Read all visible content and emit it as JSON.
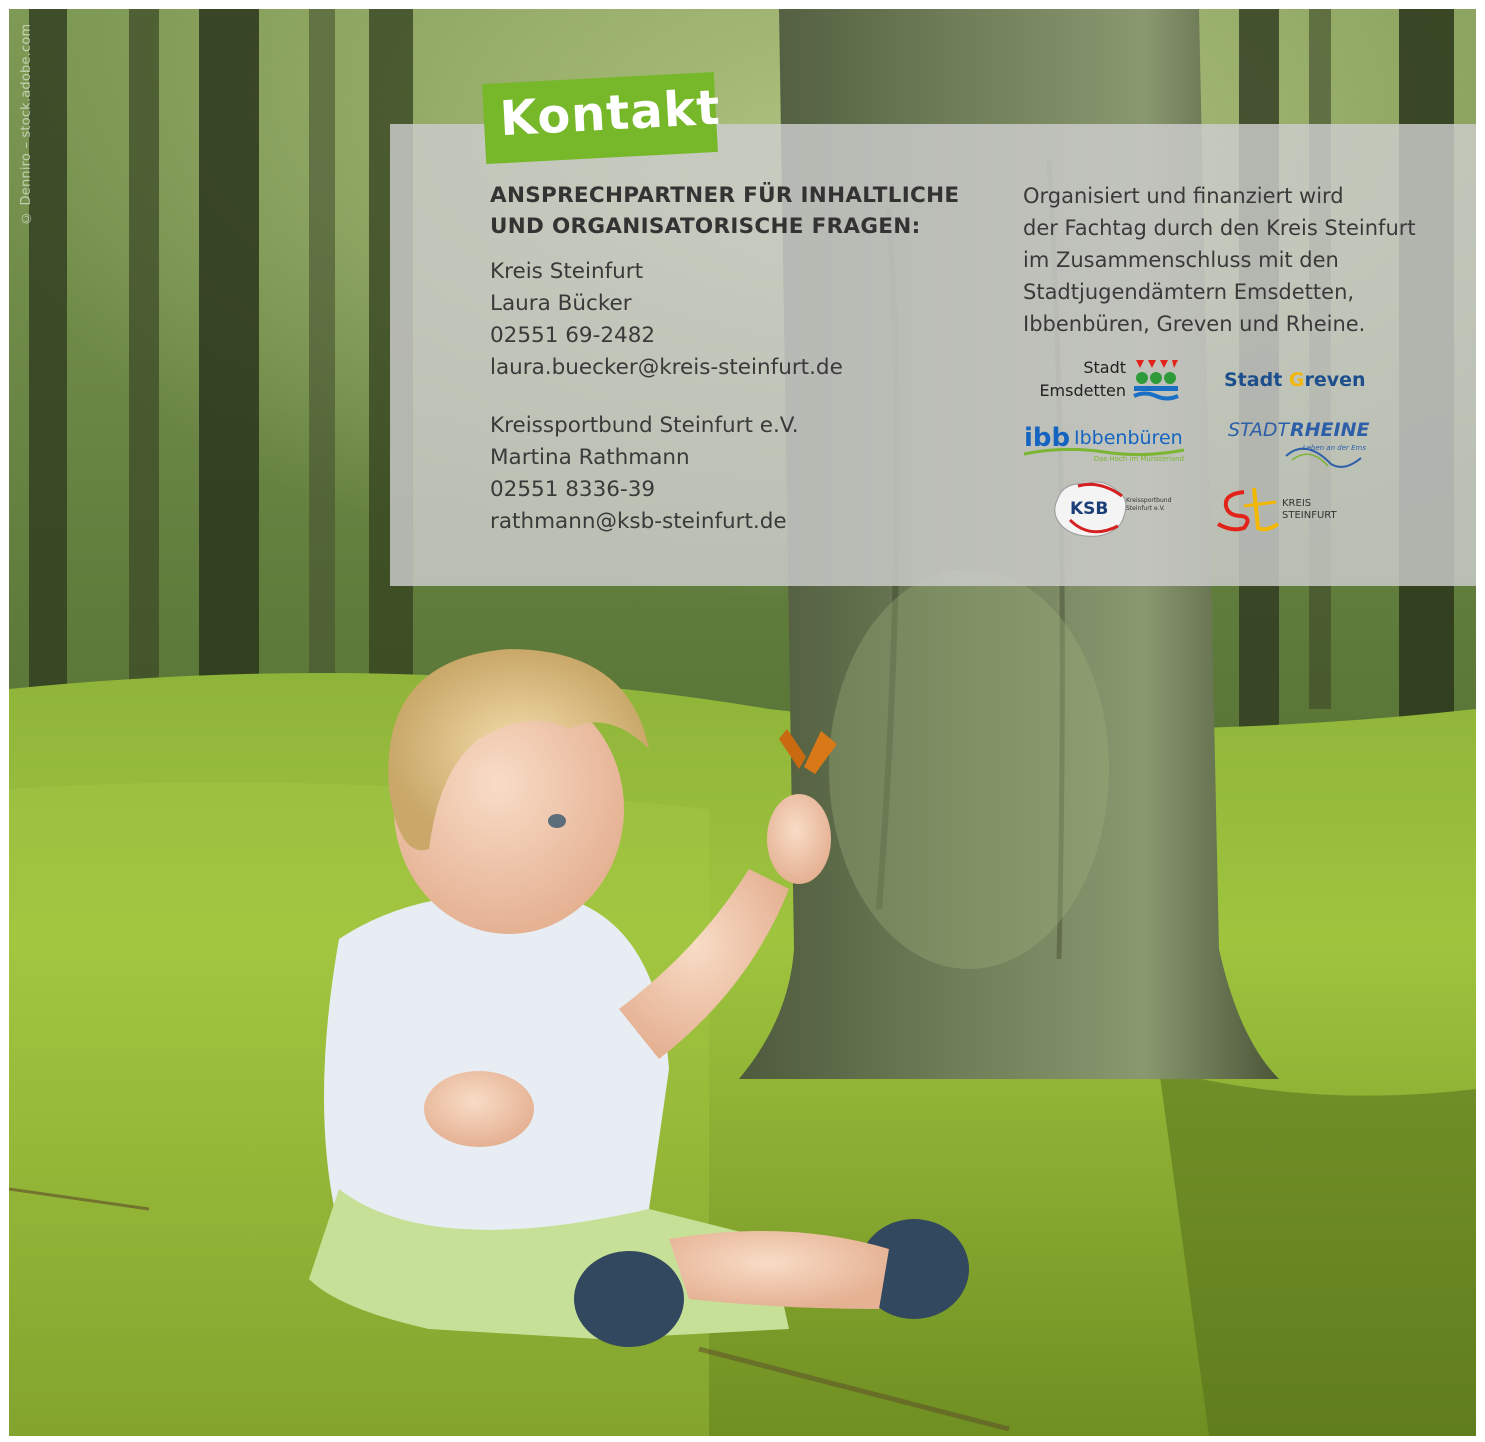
{
  "photo_credit": "© Denniro – stock.adobe.com",
  "badge": {
    "title": "Kontakt",
    "color": "#76b82a"
  },
  "contact": {
    "heading_line1": "ANSPRECHPARTNER FÜR INHALTLICHE",
    "heading_line2": "UND ORGANISATORISCHE FRAGEN:",
    "persons": [
      {
        "organization": "Kreis Steinfurt",
        "name": "Laura Bücker",
        "phone": "02551 69-2482",
        "email": "laura.buecker@kreis-steinfurt.de"
      },
      {
        "organization": "Kreissportbund Steinfurt e.V.",
        "name": "Martina Rathmann",
        "phone": "02551 8336-39",
        "email": "rathmann@ksb-steinfurt.de"
      }
    ]
  },
  "organizer": {
    "lines": [
      "Organisiert und finanziert wird",
      "der Fachtag durch den Kreis Steinfurt",
      "im Zusammenschluss mit den",
      "Stadtjugendämtern Emsdetten,",
      "Ibbenbüren, Greven und Rheine."
    ]
  },
  "logos": {
    "emsdetten": {
      "line1": "Stadt",
      "line2": "Emsdetten",
      "icon": "emsdetten-crest-icon"
    },
    "greven": {
      "part1": "Stadt ",
      "letter": "G",
      "part2": "reven"
    },
    "ibbenbueren": {
      "mark": "ibb",
      "name": "Ibbenbüren",
      "tagline": "Das Hoch im Münsterland"
    },
    "rheine": {
      "stadt": "STADT",
      "name": "RHEINE",
      "tagline": "Leben an der Ems"
    },
    "ksb": {
      "mark": "KSB",
      "line1": "Kreissportbund",
      "line2": "Steinfurt e.V."
    },
    "kreis": {
      "line1": "KREIS",
      "line2": "STEINFURT",
      "icon": "kreis-steinfurt-st-icon"
    }
  },
  "colors": {
    "accent_green": "#76b82a",
    "panel_gray": "#cdcdcd",
    "text_dark": "#333333",
    "greven_blue": "#1c4f8c",
    "greven_yellow": "#f2b705",
    "ibb_blue": "#1565c0",
    "ibb_green": "#7bb531",
    "rheine_blue": "#2d5ea8",
    "ksb_red": "#d42020",
    "kreis_red": "#e2231a",
    "kreis_yellow": "#f5b800"
  }
}
